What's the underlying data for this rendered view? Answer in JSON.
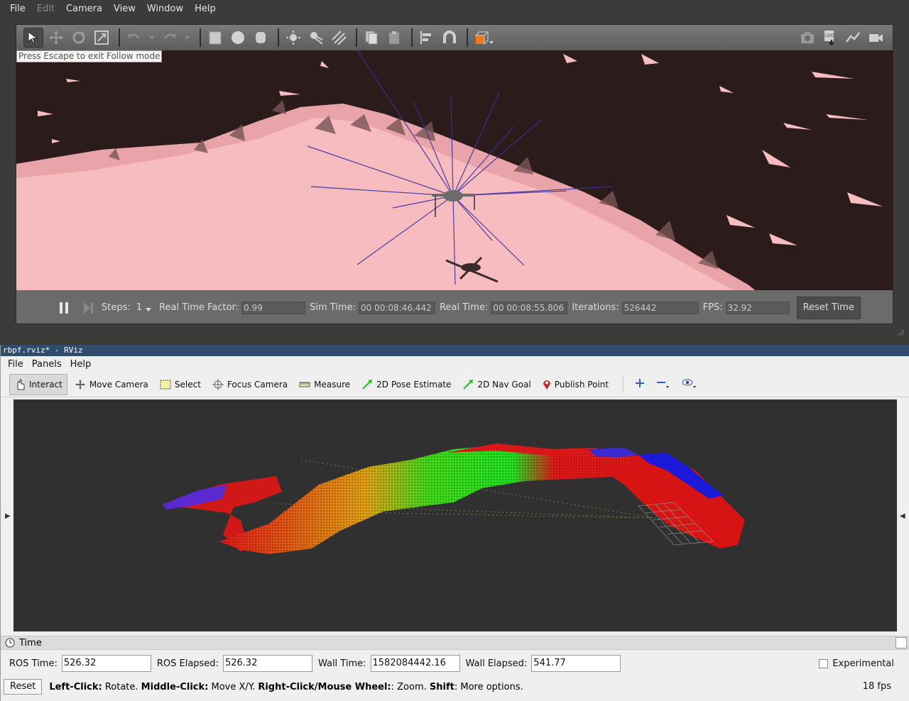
{
  "gazebo": {
    "menu": [
      {
        "label": "File",
        "enabled": true
      },
      {
        "label": "Edit",
        "enabled": false
      },
      {
        "label": "Camera",
        "enabled": true
      },
      {
        "label": "View",
        "enabled": true
      },
      {
        "label": "Window",
        "enabled": true
      },
      {
        "label": "Help",
        "enabled": true
      }
    ],
    "follow_message": "Press Escape to exit Follow mode",
    "status": {
      "steps_label": "Steps:",
      "steps_value": "1",
      "rtf_label": "Real Time Factor:",
      "rtf_value": "0.99",
      "sim_time_label": "Sim Time:",
      "sim_time_value": "00 00:08:46.442",
      "real_time_label": "Real Time:",
      "real_time_value": "00 00:08:55.806",
      "iterations_label": "Iterations:",
      "iterations_value": "526442",
      "fps_label": "FPS:",
      "fps_value": "32.92",
      "reset_label": "Reset Time"
    },
    "colors": {
      "terrain": "#f4b9be",
      "sky": "#2b1b1b",
      "ray": "#3a2fa0"
    }
  },
  "rviz": {
    "title": "rbpf.rviz* - RViz",
    "menu": [
      "File",
      "Panels",
      "Help"
    ],
    "tools": [
      {
        "label": "Interact",
        "icon": "hand-icon",
        "active": true
      },
      {
        "label": "Move Camera",
        "icon": "move-camera-icon",
        "active": false
      },
      {
        "label": "Select",
        "icon": "select-icon",
        "active": false
      },
      {
        "label": "Focus Camera",
        "icon": "focus-icon",
        "active": false
      },
      {
        "label": "Measure",
        "icon": "ruler-icon",
        "active": false
      },
      {
        "label": "2D Pose Estimate",
        "icon": "pose-arrow-icon",
        "active": false
      },
      {
        "label": "2D Nav Goal",
        "icon": "nav-arrow-icon",
        "active": false
      },
      {
        "label": "Publish Point",
        "icon": "map-pin-icon",
        "active": false
      }
    ],
    "time_panel": {
      "title": "Time",
      "ros_time_label": "ROS Time:",
      "ros_time": "526.32",
      "ros_elapsed_label": "ROS Elapsed:",
      "ros_elapsed": "526.32",
      "wall_time_label": "Wall Time:",
      "wall_time": "1582084442.16",
      "wall_elapsed_label": "Wall Elapsed:",
      "wall_elapsed": "541.77",
      "experimental_label": "Experimental",
      "experimental_checked": false
    },
    "status": {
      "reset_label": "Reset",
      "hint": [
        {
          "bold": "Left-Click:",
          "text": " Rotate. "
        },
        {
          "bold": "Middle-Click:",
          "text": " Move X/Y. "
        },
        {
          "bold": "Right-Click/Mouse Wheel:",
          "text": ": Zoom. "
        },
        {
          "bold": "Shift",
          "text": ": More options."
        }
      ],
      "fps": "18 fps"
    },
    "colors": {
      "background": "#303030",
      "pointcloud": [
        "#0a1bd0",
        "#e01010",
        "#18e010"
      ]
    }
  }
}
